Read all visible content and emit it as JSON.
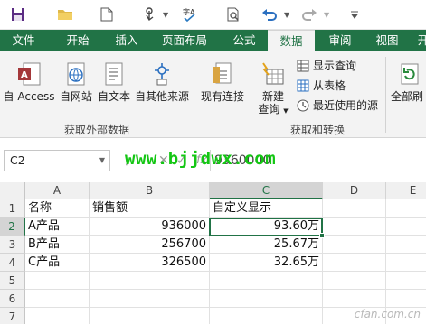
{
  "tabs": [
    "文件",
    "开始",
    "插入",
    "页面布局",
    "公式",
    "数据",
    "审阅",
    "视图",
    "开"
  ],
  "active_tab_index": 5,
  "ribbon": {
    "get_external": {
      "buttons": [
        "自 Access",
        "自网站",
        "自文本",
        "自其他来源"
      ],
      "label": "获取外部数据"
    },
    "existing_connections": "现有连接",
    "get_transform": {
      "new_query_line1": "新建",
      "new_query_line2": "查询",
      "show_queries": "显示查询",
      "from_table": "从表格",
      "recent_sources": "最近使用的源",
      "label": "获取和转换"
    },
    "refresh_all": "全部刷"
  },
  "namebox": "C2",
  "formula": "9360000",
  "watermark": "www.bjjdwx.com",
  "grid": {
    "columns": [
      "A",
      "B",
      "C",
      "D",
      "E"
    ],
    "selected_column": "C",
    "rows": [
      "1",
      "2",
      "3",
      "4",
      "5",
      "6",
      "7"
    ],
    "selected_row": "2",
    "cells": [
      [
        "名称",
        "销售额",
        "自定义显示",
        "",
        ""
      ],
      [
        "A产品",
        "936000",
        "93.60万",
        "",
        ""
      ],
      [
        "B产品",
        "256700",
        "25.67万",
        "",
        ""
      ],
      [
        "C产品",
        "326500",
        "32.65万",
        "",
        ""
      ]
    ]
  },
  "site_mark": "cfan.com.cn",
  "colors": {
    "excel_green": "#217346",
    "watermark_green": "#14c614"
  }
}
